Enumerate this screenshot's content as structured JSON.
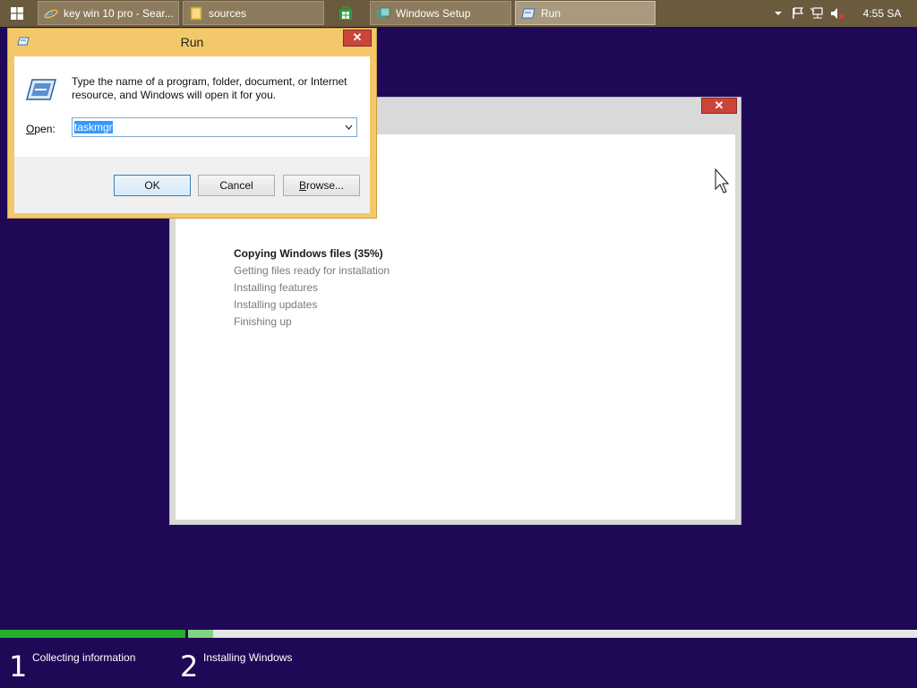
{
  "taskbar": {
    "tasks": [
      {
        "label": "key win 10 pro - Sear...",
        "icon": "ie-icon"
      },
      {
        "label": "sources",
        "icon": "folder-icon"
      },
      {
        "label": "Windows Setup",
        "icon": "setup-icon"
      },
      {
        "label": "Run",
        "icon": "run-icon"
      }
    ],
    "pinned_icon": "store-icon",
    "clock": "4:55 SA"
  },
  "run_dialog": {
    "title": "Run",
    "description": "Type the name of a program, folder, document, or Internet resource, and Windows will open it for you.",
    "open_label_prefix": "O",
    "open_label_rest": "pen:",
    "open_value": "taskmgr",
    "ok_label": "OK",
    "cancel_label": "Cancel",
    "browse_label_prefix": "B",
    "browse_label_rest": "rowse..."
  },
  "setup_window": {
    "steps": [
      {
        "label": "Copying Windows files (35%)",
        "state": "current"
      },
      {
        "label": "Getting files ready for installation",
        "state": "pending"
      },
      {
        "label": "Installing features",
        "state": "pending"
      },
      {
        "label": "Installing updates",
        "state": "pending"
      },
      {
        "label": "Finishing up",
        "state": "pending"
      }
    ]
  },
  "progress": {
    "stage1": {
      "number": "1",
      "label": "Collecting information",
      "fraction": 1.0
    },
    "stage2": {
      "number": "2",
      "label": "Installing Windows",
      "fraction": 0.035
    }
  },
  "colors": {
    "desktop": "#1f0856",
    "taskbar": "#6a5a3e",
    "run_frame": "#f2c86a",
    "progress_done": "#25b02a",
    "progress_partial": "#7fd47f"
  }
}
